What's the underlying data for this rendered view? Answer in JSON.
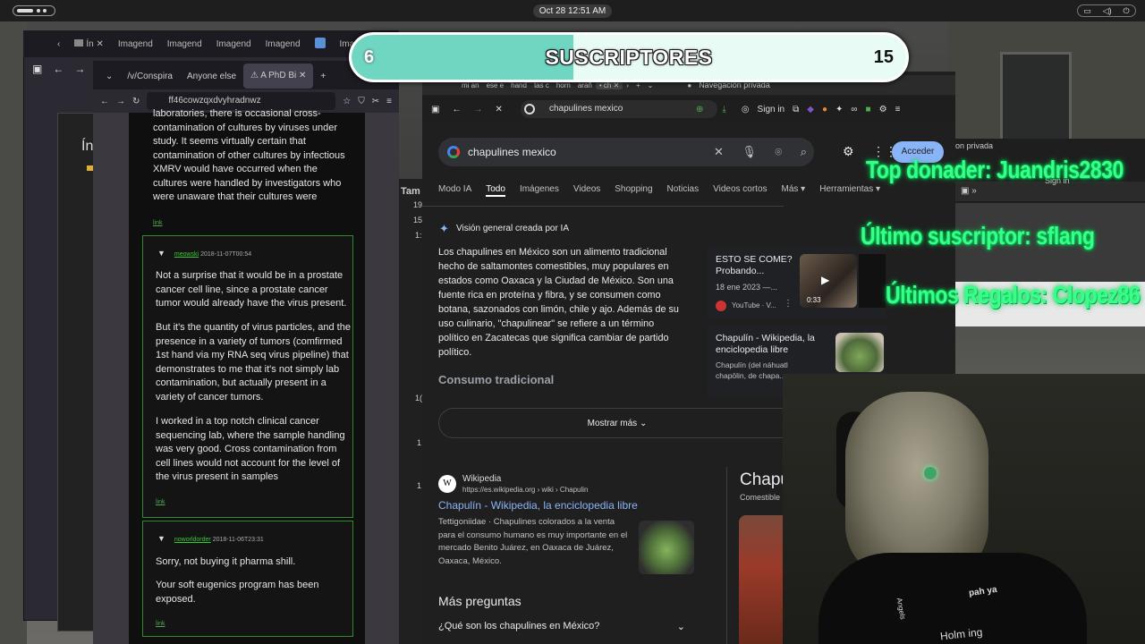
{
  "system": {
    "clock": "Oct 28  12:51 AM"
  },
  "left_browser": {
    "outer_tabs": [
      "Imagend",
      "Imagend",
      "Imagend",
      "Imagend",
      "Imagend"
    ],
    "tabs": [
      "/v/Conspira",
      "Anyone else",
      "A PhD Bi"
    ],
    "url": "ff46cowzqxdvyhradnwz",
    "sidebar_heading": "Ín",
    "side_numbers": [
      "Tam",
      "19",
      "15",
      "1:",
      "1(",
      "1",
      "1"
    ],
    "comment0_text": "laboratories, there is occasional cross-contamination of cultures by viruses under study. It seems virtually certain that contamination of other cultures by infectious XMRV would have occurred when the cultures were handled by investigators who were unaware that their cultures were infected.",
    "comments": [
      {
        "user": "meowski",
        "date": "2018-11-07T00:54",
        "paragraphs": [
          "Not a surprise that it would be in a prostate cancer cell line, since a prostate cancer tumor would already have the virus present.",
          "But it's the quantity of virus particles, and the presence in a variety of tumors (comfirmed 1st hand via my RNA seq virus pipeline) that demonstrates to me that it's not simply lab contamination, but actually present in a variety of cancer tumors.",
          "I worked in a top notch clinical cancer sequencing lab, where the sample handling was very good. Cross contamination from cell lines would not account for the level of the virus present in samples"
        ]
      },
      {
        "user": "noworldorder",
        "date": "2018-11-06T23:31",
        "paragraphs": [
          "Sorry, not buying it pharma shill.",
          "Your soft eugenics program has been exposed."
        ]
      }
    ],
    "link_label": "link"
  },
  "right_browser": {
    "tabs": [
      "mi an",
      "ese e",
      "hand",
      "tas c",
      "horn",
      "arañ",
      "ch"
    ],
    "private_label": "Navegación privada",
    "url": "chapulines mexico",
    "signin": "Sign in",
    "search_query": "chapulines mexico",
    "acceder": "Acceder",
    "tabs_search": [
      "Modo IA",
      "Todo",
      "Imágenes",
      "Videos",
      "Shopping",
      "Noticias",
      "Videos cortos",
      "Más ▾",
      "Herramientas ▾"
    ],
    "ai_title": "Visión general creada por IA",
    "ai_text": "Los chapulines en México son un alimento tradicional hecho de saltamontes comestibles, muy populares en estados como Oaxaca y la Ciudad de México. Son una fuente rica en proteína y fibra, y se consumen como botana, sazonados con limón, chile y ajo. Además de su uso culinario, \"chapulinear\" se refiere a un término político en Zacatecas que significa cambiar de partido político.",
    "consumo": "Consumo tradicional",
    "show_more": "Mostrar más",
    "video_title": "ESTO SE COME? Probando...",
    "video_date": "18 ene 2023 —...",
    "video_source": "YouTube · V...",
    "video_duration": "0:33",
    "wiki_card_title": "Chapulín - Wikipedia, la enciclopedia libre",
    "wiki_card_snip": "Chapulín (del náhuatl chapōlin, de chapa...",
    "result_site": "Wikipedia",
    "result_url": "https://es.wikipedia.org › wiki › Chapulin",
    "result_title": "Chapulín - Wikipedia, la enciclopedia libre",
    "result_snippet": "Tettigoniidae · Chapulines colorados a la venta para el consumo humano es muy importante en el mercado Benito Juárez, en Oaxaca de Juárez, Oaxaca, México.",
    "mas_preguntas": "Más preguntas",
    "question1": "¿Qué son los chapulines en México?",
    "kp_title": "Chapu",
    "kp_sub": "Comestible"
  },
  "back_browser": {
    "private_label": "on privada",
    "signin": "Sign in"
  },
  "overlay": {
    "sub_current": "6",
    "sub_label": "SUSCRIPTORES",
    "sub_goal": "15",
    "sub_progress": 0.4,
    "top_donor": "Top donader: Juandris2830",
    "last_sub": "Último suscriptor: sflang",
    "last_gifts": "Últimos Regalos: Clopez86"
  },
  "webcam": {
    "shirt_text": "pah ya",
    "shirt_text2": "Angels",
    "shirt_text3": "Holm ing"
  },
  "colors": {
    "neon": "#39ff8a",
    "subbar": "#6fd6c2",
    "google_link": "#8ab4f8",
    "comment_border": "#2e8b2e"
  }
}
